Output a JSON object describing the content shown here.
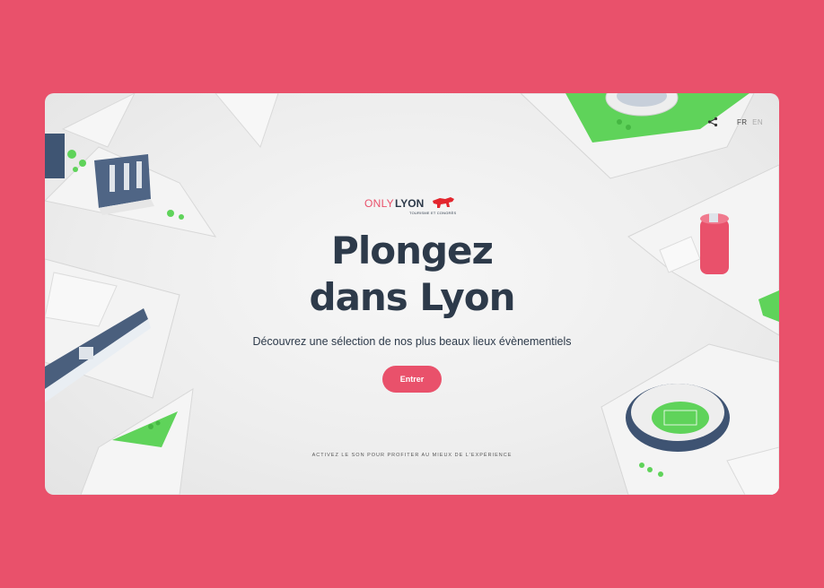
{
  "header": {
    "share_icon": "share-icon",
    "languages": [
      {
        "code": "FR",
        "active": true
      },
      {
        "code": "EN",
        "active": false
      }
    ]
  },
  "logo": {
    "only": "ONLY",
    "lyon": "LYON",
    "tagline": "TOURISME ET CONGRÈS",
    "icon": "lion-icon"
  },
  "hero": {
    "title_line1": "Plongez",
    "title_line2": "dans Lyon",
    "subtitle": "Découvrez une sélection de nos plus beaux lieux évènementiels",
    "enter_label": "Entrer"
  },
  "footer": {
    "sound_hint": "ACTIVEZ LE SON POUR PROFITER AU MIEUX DE L'EXPÉRIENCE"
  },
  "colors": {
    "brand": "#e9516b",
    "text": "#2d3a4a",
    "grass": "#5fd35a",
    "background": "#eeeeee"
  }
}
